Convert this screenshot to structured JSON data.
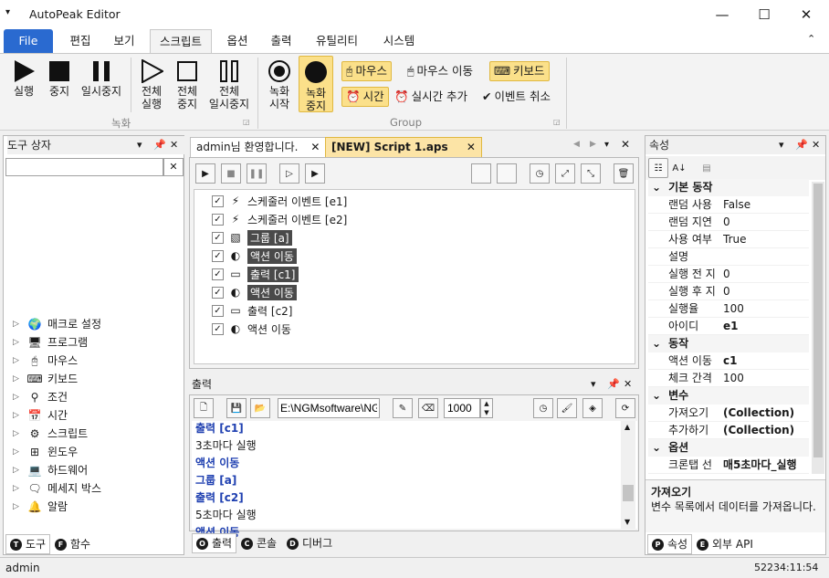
{
  "window": {
    "title": "AutoPeak Editor",
    "menu_glyph": "▾",
    "minimize": "—",
    "maximize": "☐",
    "close": "✕"
  },
  "menu": {
    "file": "File",
    "tabs": [
      "편집",
      "보기",
      "스크립트",
      "옵션",
      "출력",
      "유틸리티",
      "시스템"
    ],
    "collapse": "⌃"
  },
  "ribbon": {
    "record_group_label": "녹화",
    "group_label": "Group",
    "run": "실행",
    "stop": "중지",
    "pause": "일시중지",
    "run_all": [
      "전체",
      "실행"
    ],
    "stop_all": [
      "전체",
      "중지"
    ],
    "pause_all": [
      "전체",
      "일시중지"
    ],
    "rec_start": [
      "녹화",
      "시작"
    ],
    "rec_stop": [
      "녹화",
      "중지"
    ],
    "mouse": "마우스",
    "mouse_move": "마우스 이동",
    "keyboard": "키보드",
    "time": "시간",
    "realtime_add": "실시간 추가",
    "event_cancel": "이벤트 취소"
  },
  "toolbox": {
    "title": "도구 상자",
    "search_value": "",
    "items": [
      "매크로 설정",
      "프로그램",
      "마우스",
      "키보드",
      "조건",
      "시간",
      "스크립트",
      "윈도우",
      "하드웨어",
      "메세지 박스",
      "알람"
    ],
    "tabs": [
      {
        "letter": "T",
        "label": "도구"
      },
      {
        "letter": "F",
        "label": "함수"
      }
    ]
  },
  "editor": {
    "tabs": [
      "admin님 환영합니다.",
      "[NEW] Script 1.aps"
    ],
    "rows": [
      {
        "label": "스케줄러 이벤트 [e1]",
        "dark": false
      },
      {
        "label": "스케줄러 이벤트 [e2]",
        "dark": false
      },
      {
        "label": "그룹 [a]",
        "dark": true
      },
      {
        "label": "액션 이동",
        "dark": true
      },
      {
        "label": "출력 [c1]",
        "dark": true
      },
      {
        "label": "액션 이동",
        "dark": true
      },
      {
        "label": "출력 [c2]",
        "dark": false
      },
      {
        "label": "액션 이동",
        "dark": false
      }
    ]
  },
  "output": {
    "title": "출력",
    "path": "E:\\NGMsoftware\\NG",
    "interval": "1000",
    "lines": [
      {
        "text": "출력 [c1]",
        "blue": true
      },
      {
        "text": "3초마다 실행",
        "blue": false
      },
      {
        "text": "액션 이동",
        "blue": true
      },
      {
        "text": "그룹 [a]",
        "blue": true
      },
      {
        "text": "출력 [c2]",
        "blue": true
      },
      {
        "text": "5초마다 실행",
        "blue": false
      },
      {
        "text": "액션 이동",
        "blue": true
      }
    ],
    "tabs": [
      {
        "letter": "O",
        "label": "출력"
      },
      {
        "letter": "C",
        "label": "콘솔"
      },
      {
        "letter": "D",
        "label": "디버그"
      }
    ]
  },
  "properties": {
    "title": "속성",
    "categories": [
      {
        "name": "기본 동작",
        "rows": [
          [
            "랜덤 사용",
            "False"
          ],
          [
            "랜덤 지연",
            "0"
          ],
          [
            "사용 여부",
            "True"
          ],
          [
            "설명",
            ""
          ],
          [
            "실행 전 지",
            "0"
          ],
          [
            "실행 후 지",
            "0"
          ],
          [
            "실행율",
            "100"
          ],
          [
            "아이디",
            "e1"
          ]
        ]
      },
      {
        "name": "동작",
        "rows": [
          [
            "액션 이동",
            "c1"
          ],
          [
            "체크 간격",
            "100"
          ]
        ]
      },
      {
        "name": "변수",
        "rows": [
          [
            "가져오기",
            "(Collection)"
          ],
          [
            "추가하기",
            "(Collection)"
          ]
        ]
      },
      {
        "name": "옵션",
        "rows": [
          [
            "크론탭 선",
            "매5초마다_실행"
          ]
        ]
      }
    ],
    "desc_title": "가져오기",
    "desc_text": "변수 목록에서 데이터를 가져옵니다.",
    "tabs": [
      {
        "letter": "P",
        "label": "속성"
      },
      {
        "letter": "E",
        "label": "외부 API"
      }
    ]
  },
  "status": {
    "user": "admin",
    "clock": "52234:11:54"
  }
}
